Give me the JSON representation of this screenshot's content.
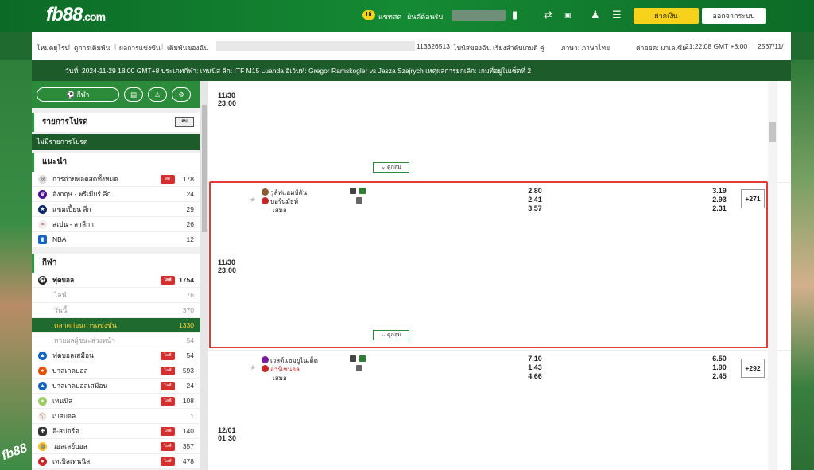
{
  "header": {
    "logo": "fb88",
    "logo_suffix": ".com",
    "chat_icon": "Hi",
    "chat_label": "แชทสด",
    "welcome": "ยินดีต้อนรับ,",
    "deposit": "ฝากเงิน",
    "logout": "ออกจากระบบ"
  },
  "infobar": {
    "items": [
      "โหมดยุโรป",
      "ดูการเดิมพัน",
      "ผลการแข่งขัน",
      "เดิมพันของฉัน"
    ],
    "account": "113326513",
    "balance": "โบนัสของฉัน",
    "sort": "เรียงลำดับเกมดี",
    "odds_type": "คู่",
    "language": "ภาษา: ภาษาไทย",
    "odds_format": "ค่าออด: มาเลเซีย",
    "time": "21:22:08 GMT +8:00",
    "year": "2567/11/"
  },
  "ticker": "วันที่: 2024-11-29 18:00 GMT+8 ประเภทกีฬา: เทนนิส ลีก: ITF M15 Luanda อีเว้นท์: Gregor Ramskogler vs Jasza Szajrych เหตุผลการยกเลิก: เกมที่อยู่ในเซ็ตที่ 2",
  "sidebar": {
    "tab_label": "กีฬา",
    "fav_title": "รายการโปรด",
    "fav_btn": "ลบ",
    "fav_empty": "ไม่มีรายการโปรด",
    "rec_title": "แนะนำ",
    "recommended": [
      {
        "label": "การถ่ายทอดสดทั้งหมด",
        "count": "178",
        "live": "สด"
      },
      {
        "label": "อังกฤษ - พรีเมียร์ ลีก",
        "count": "24"
      },
      {
        "label": "แชมเปี้ยน ลีก",
        "count": "29"
      },
      {
        "label": "สเปน - ลาลีกา",
        "count": "26"
      },
      {
        "label": "NBA",
        "count": "12"
      }
    ],
    "sports_title": "กีฬา",
    "football": {
      "label": "ฟุตบอล",
      "live": "ไลฟ์",
      "count": "1754"
    },
    "subs": [
      {
        "label": "ไลฟ์",
        "count": "76"
      },
      {
        "label": "วันนี้",
        "count": "370"
      },
      {
        "label": "ตลาดก่อนการแข่งขัน",
        "count": "1330"
      },
      {
        "label": "ทายผลผู้ชนะล่วงหน้า",
        "count": "54"
      }
    ],
    "sports": [
      {
        "label": "ฟุตบอลเสมือน",
        "live": "ไลฟ์",
        "count": "54"
      },
      {
        "label": "บาสเกตบอล",
        "live": "ไลฟ์",
        "count": "593"
      },
      {
        "label": "บาสเกตบอลเสมือน",
        "live": "ไลฟ์",
        "count": "24"
      },
      {
        "label": "เทนนิส",
        "live": "ไลฟ์",
        "count": "108"
      },
      {
        "label": "เบสบอล",
        "count": "1"
      },
      {
        "label": "อี-สปอร์ต",
        "live": "ไลฟ์",
        "count": "140"
      },
      {
        "label": "วอลเลย์บอล",
        "live": "ไลฟ์",
        "count": "357"
      },
      {
        "label": "เทเบิลเทนนิส",
        "live": "ไลฟ์",
        "count": "478"
      }
    ]
  },
  "main": {
    "expand_label": "ดูกลุ่ม",
    "match1": {
      "date": "11/30",
      "time": "23:00"
    },
    "match2": {
      "date": "11/30",
      "time": "23:00",
      "home": "วูล์ฟแฮมป์ตัน",
      "away": "บอร์นมัธท์",
      "draw": "เสมอ",
      "more": "+271",
      "x12": [
        "2.80",
        "2.41",
        "3.57"
      ],
      "x12_ht": [
        "3.19",
        "2.93",
        "2.31"
      ]
    },
    "match3": {
      "date": "12/01",
      "time": "01:30",
      "home": "เวสต์แฮมยูไนเต็ด",
      "away": "อาร์เซนอล",
      "draw": "เสมอ",
      "more": "+292",
      "x12": [
        "7.10",
        "1.43",
        "4.66"
      ],
      "x12_ht": [
        "6.50",
        "1.90",
        "2.45"
      ]
    }
  }
}
